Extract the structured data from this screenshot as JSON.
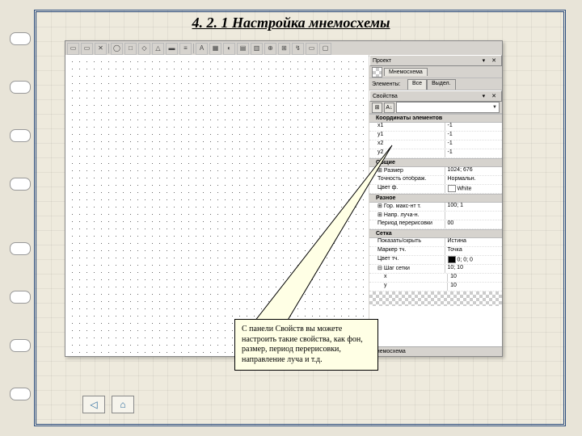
{
  "title": "4. 2. 1 Настройка мнемосхемы",
  "callout": "С панели Свойств вы можете настроить такие свойства, как фон, размер, период перерисовки, направление луча и т.д.",
  "panel": {
    "proj_header": "Проект",
    "proj_tab_label": "Мнемосхема",
    "elements_label": "Элементы:",
    "tab_all": "Все",
    "tab_selected": "Выдел.",
    "properties_label": "Свойства",
    "status": "Мнемосхема"
  },
  "props": {
    "sec_coord": "Координаты элементов",
    "x1": "x1",
    "x1_v": "-1",
    "y1": "y1",
    "y1_v": "-1",
    "x2": "x2",
    "x2_v": "-1",
    "y2": "y2",
    "y2_v": "-1",
    "sec_general": "Общие",
    "size": "Размер",
    "size_v": "1024; 676",
    "visibility": "Точность отображ.",
    "visibility_v": "Нормальн.",
    "bgcolor": "Цвет ф.",
    "bgcolor_v": "White",
    "sec_ray": "Разное",
    "max_ray": "Гор. макс-нт т.",
    "max_ray_v": "100; 1",
    "ray_dir": "Напр. луча-н.",
    "redraw": "Период перерисовки",
    "redraw_v": "00",
    "sec_grid": "Сетка",
    "show_grid": "Показать/скрыть",
    "show_grid_v": "Истина",
    "marker": "Маркер тч.",
    "marker_v": "Точка",
    "marker_col": "Цвет тч.",
    "marker_col_v": "0; 0; 0",
    "grid_step": "Шаг сетки",
    "grid_step_v": "10; 10",
    "gx": "x",
    "gx_v": "10",
    "gy": "y",
    "gy_v": "10"
  }
}
